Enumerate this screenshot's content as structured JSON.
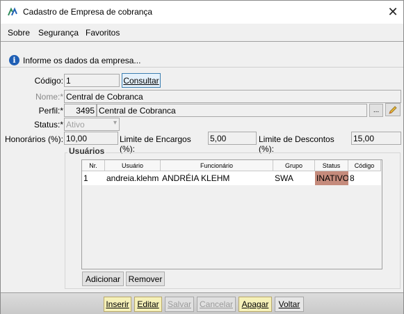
{
  "window": {
    "title": "Cadastro de Empresa de cobrança",
    "close_symbol": "✕"
  },
  "menu": {
    "items": [
      "Sobre",
      "Segurança",
      "Favoritos"
    ]
  },
  "info": {
    "text": "Informe os dados da empresa...",
    "icon": "info-icon"
  },
  "form": {
    "codigo": {
      "label": "Código:",
      "value": "1",
      "button": "Consultar"
    },
    "nome": {
      "label": "Nome:*",
      "value": "Central de Cobranca"
    },
    "perfil": {
      "label": "Perfil:*",
      "code": "3495",
      "value": "Central de Cobranca",
      "lookup_button": "...",
      "edit_icon": "pencil-icon"
    },
    "status": {
      "label": "Status:*",
      "value": "Ativo"
    },
    "honorarios": {
      "label": "Honorários (%):",
      "value": "10,00"
    },
    "limite_encargos": {
      "label": "Limite de Encargos (%):",
      "value": "5,00"
    },
    "limite_descontos": {
      "label": "Limite de Descontos (%):",
      "value": "15,00"
    }
  },
  "usuarios": {
    "title": "Usuários",
    "columns": [
      "Nr.",
      "Usuário",
      "Funcionário",
      "Grupo",
      "Status",
      "Código"
    ],
    "rows": [
      {
        "nr": "1",
        "usuario": "andreia.klehm",
        "funcionario": "ANDRÉIA KLEHM",
        "grupo": "SWA",
        "status": "INATIVO",
        "codigo": "8"
      }
    ],
    "add_button": "Adicionar",
    "remove_button": "Remover"
  },
  "footer": {
    "inserir": "Inserir",
    "editar": "Editar",
    "salvar": "Salvar",
    "cancelar": "Cancelar",
    "apagar": "Apagar",
    "voltar": "Voltar"
  },
  "colors": {
    "inactive_status": "#c58b7c",
    "active_button": "#f5f0b8",
    "info_icon": "#1f5fb5"
  }
}
